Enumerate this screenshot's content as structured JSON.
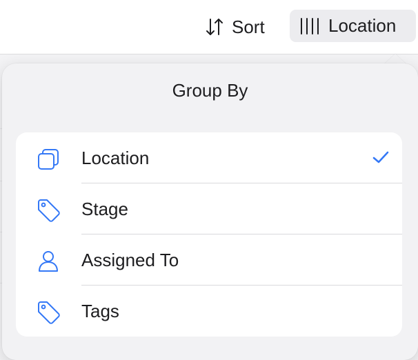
{
  "toolbar": {
    "sort_label": "Sort",
    "location_label": "Location"
  },
  "popover": {
    "title": "Group By",
    "options": [
      {
        "label": "Location",
        "icon": "layers-icon",
        "selected": true
      },
      {
        "label": "Stage",
        "icon": "tag-icon",
        "selected": false
      },
      {
        "label": "Assigned To",
        "icon": "person-icon",
        "selected": false
      },
      {
        "label": "Tags",
        "icon": "tag-icon",
        "selected": false
      }
    ]
  },
  "colors": {
    "accent": "#3478f6",
    "text": "#1d1d1f",
    "toolbar_button_bg": "#ececef",
    "popover_bg": "#f2f2f4",
    "list_bg": "#ffffff",
    "separator": "#d9d9dc"
  }
}
